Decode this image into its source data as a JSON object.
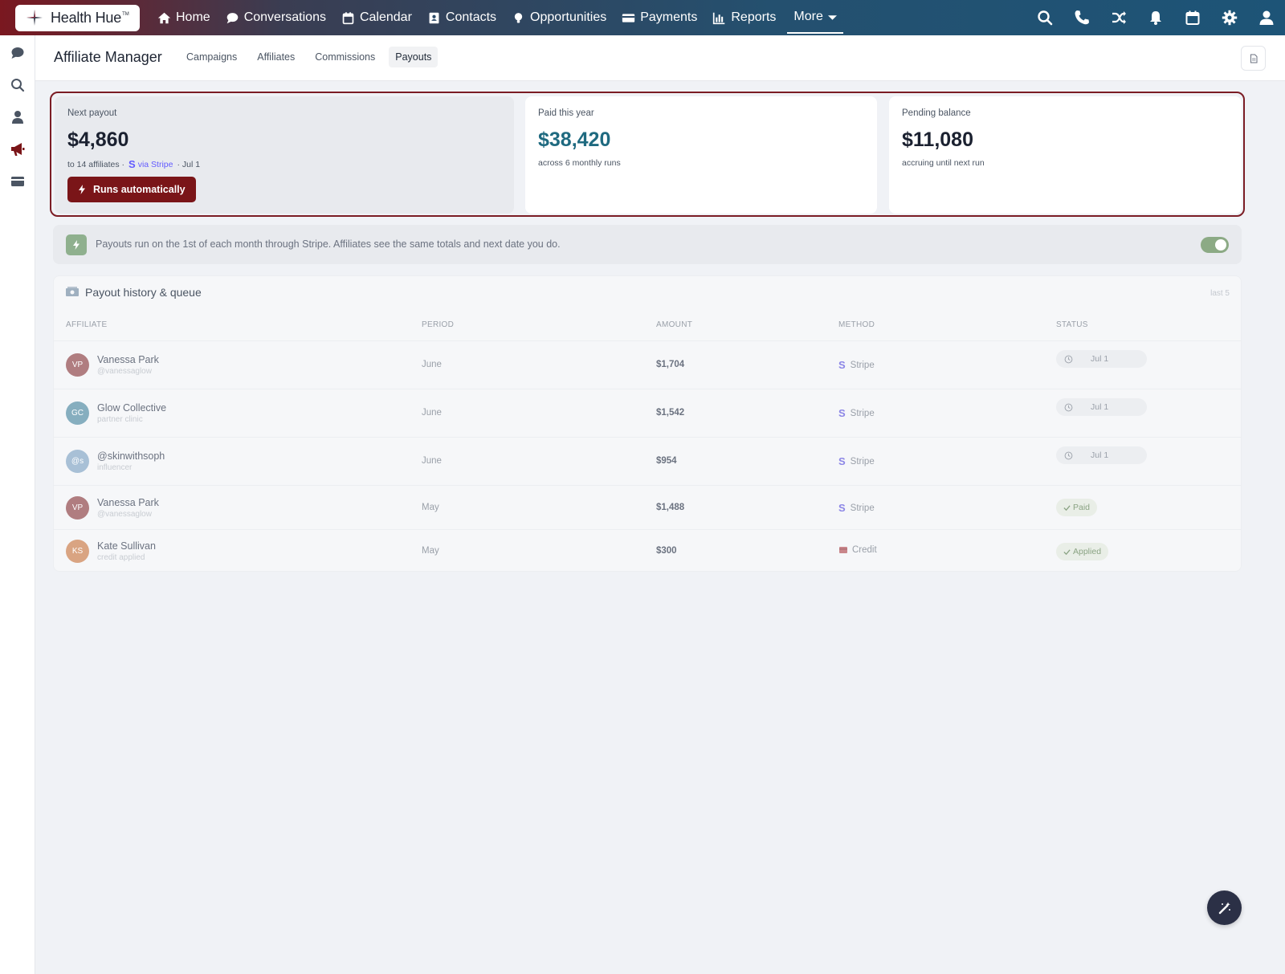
{
  "brand": {
    "name": "Health Hue",
    "mark": "TM"
  },
  "nav": {
    "items": [
      {
        "label": "Home",
        "icon": "home-icon"
      },
      {
        "label": "Conversations",
        "icon": "chat-icon"
      },
      {
        "label": "Calendar",
        "icon": "calendar-icon"
      },
      {
        "label": "Contacts",
        "icon": "contact-card-icon"
      },
      {
        "label": "Opportunities",
        "icon": "lightbulb-icon"
      },
      {
        "label": "Payments",
        "icon": "credit-card-icon"
      },
      {
        "label": "Reports",
        "icon": "bar-chart-icon"
      }
    ],
    "more_label": "More",
    "right_icons": [
      "search-icon",
      "phone-icon",
      "shuffle-icon",
      "bell-icon",
      "calendar-icon",
      "gear-icon",
      "user-icon"
    ]
  },
  "rail": {
    "icons": [
      "chat-icon",
      "search-icon",
      "user-icon",
      "megaphone-icon",
      "card-icon"
    ]
  },
  "header": {
    "title": "Affiliate Manager",
    "tabs": [
      {
        "label": "Campaigns",
        "active": false
      },
      {
        "label": "Affiliates",
        "active": false
      },
      {
        "label": "Commissions",
        "active": false
      },
      {
        "label": "Payouts",
        "active": true
      }
    ]
  },
  "cards": {
    "next_payout": {
      "label": "Next payout",
      "value": "$4,860",
      "sub_prefix": "to 14 affiliates ·",
      "stripe_glyph": "S",
      "via": "via Stripe",
      "date": "· Jul 1",
      "button": "Runs automatically"
    },
    "paid_year": {
      "label": "Paid this year",
      "value": "$38,420",
      "sub": "across 6 monthly runs"
    },
    "pending": {
      "label": "Pending balance",
      "value": "$11,080",
      "sub": "accruing until next run"
    }
  },
  "info": {
    "text": "Payouts run on the 1st of each month through Stripe. Affiliates see the same totals and next date you do.",
    "toggle_on": true
  },
  "table": {
    "title": "Payout history & queue",
    "note": "last 5",
    "columns": [
      "AFFILIATE",
      "PERIOD",
      "AMOUNT",
      "METHOD",
      "STATUS"
    ],
    "rows": [
      {
        "initials": "VP",
        "avatar_color": "#b07d80",
        "name": "Vanessa Park",
        "sub": "@vanessaglow",
        "period": "June",
        "amount": "$1,704",
        "method": "Stripe",
        "method_glyph": "S",
        "status": "Jul 1",
        "status_type": "queued"
      },
      {
        "initials": "GC",
        "avatar_color": "#86aebf",
        "name": "Glow Collective",
        "sub": "partner clinic",
        "period": "June",
        "amount": "$1,542",
        "method": "Stripe",
        "method_glyph": "S",
        "status": "Jul 1",
        "status_type": "queued"
      },
      {
        "initials": "@s",
        "avatar_color": "#a8c0d6",
        "name": "@skinwithsoph",
        "sub": "influencer",
        "period": "June",
        "amount": "$954",
        "method": "Stripe",
        "method_glyph": "S",
        "status": "Jul 1",
        "status_type": "queued"
      },
      {
        "initials": "VP",
        "avatar_color": "#b07d80",
        "name": "Vanessa Park",
        "sub": "@vanessaglow",
        "period": "May",
        "amount": "$1,488",
        "method": "Stripe",
        "method_glyph": "S",
        "status": "Paid",
        "status_type": "paid"
      },
      {
        "initials": "KS",
        "avatar_color": "#d9a482",
        "name": "Kate Sullivan",
        "sub": "credit applied",
        "period": "May",
        "amount": "$300",
        "method": "Credit",
        "method_glyph": "",
        "status": "Applied",
        "status_type": "applied"
      }
    ]
  },
  "colors": {
    "brand_red": "#7a1518",
    "teal": "#1f6a80",
    "stripe": "#635bff",
    "toggle": "#8caa85"
  }
}
